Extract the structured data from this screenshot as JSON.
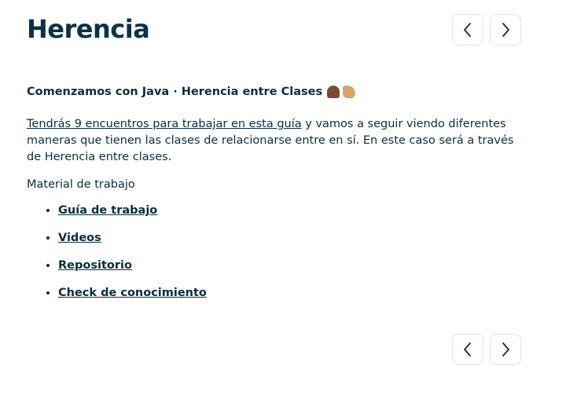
{
  "header": {
    "title": "Herencia"
  },
  "content": {
    "subtitle": "Comenzamos con Java · Herencia entre Clases",
    "intro_link": "Tendrás 9 encuentros para trabajar en esta guía",
    "intro_rest": " y vamos a seguir viendo diferentes maneras que tienen las clases de relacionarse entre en sí. En este caso será a través de Herencia entre clases.",
    "material_label": "Material de trabajo",
    "materials": [
      {
        "label": "Guía de trabajo"
      },
      {
        "label": "Videos"
      },
      {
        "label": "Repositorio"
      },
      {
        "label": "Check de conocimiento"
      }
    ]
  },
  "icons": {
    "prev": "chevron-left-icon",
    "next": "chevron-right-icon",
    "emoji_1": "folded-hands-emoji",
    "emoji_2": "flexed-biceps-emoji"
  },
  "colors": {
    "text": "#0b2e3f",
    "title": "#0b3347",
    "border": "#dfe3e6"
  }
}
